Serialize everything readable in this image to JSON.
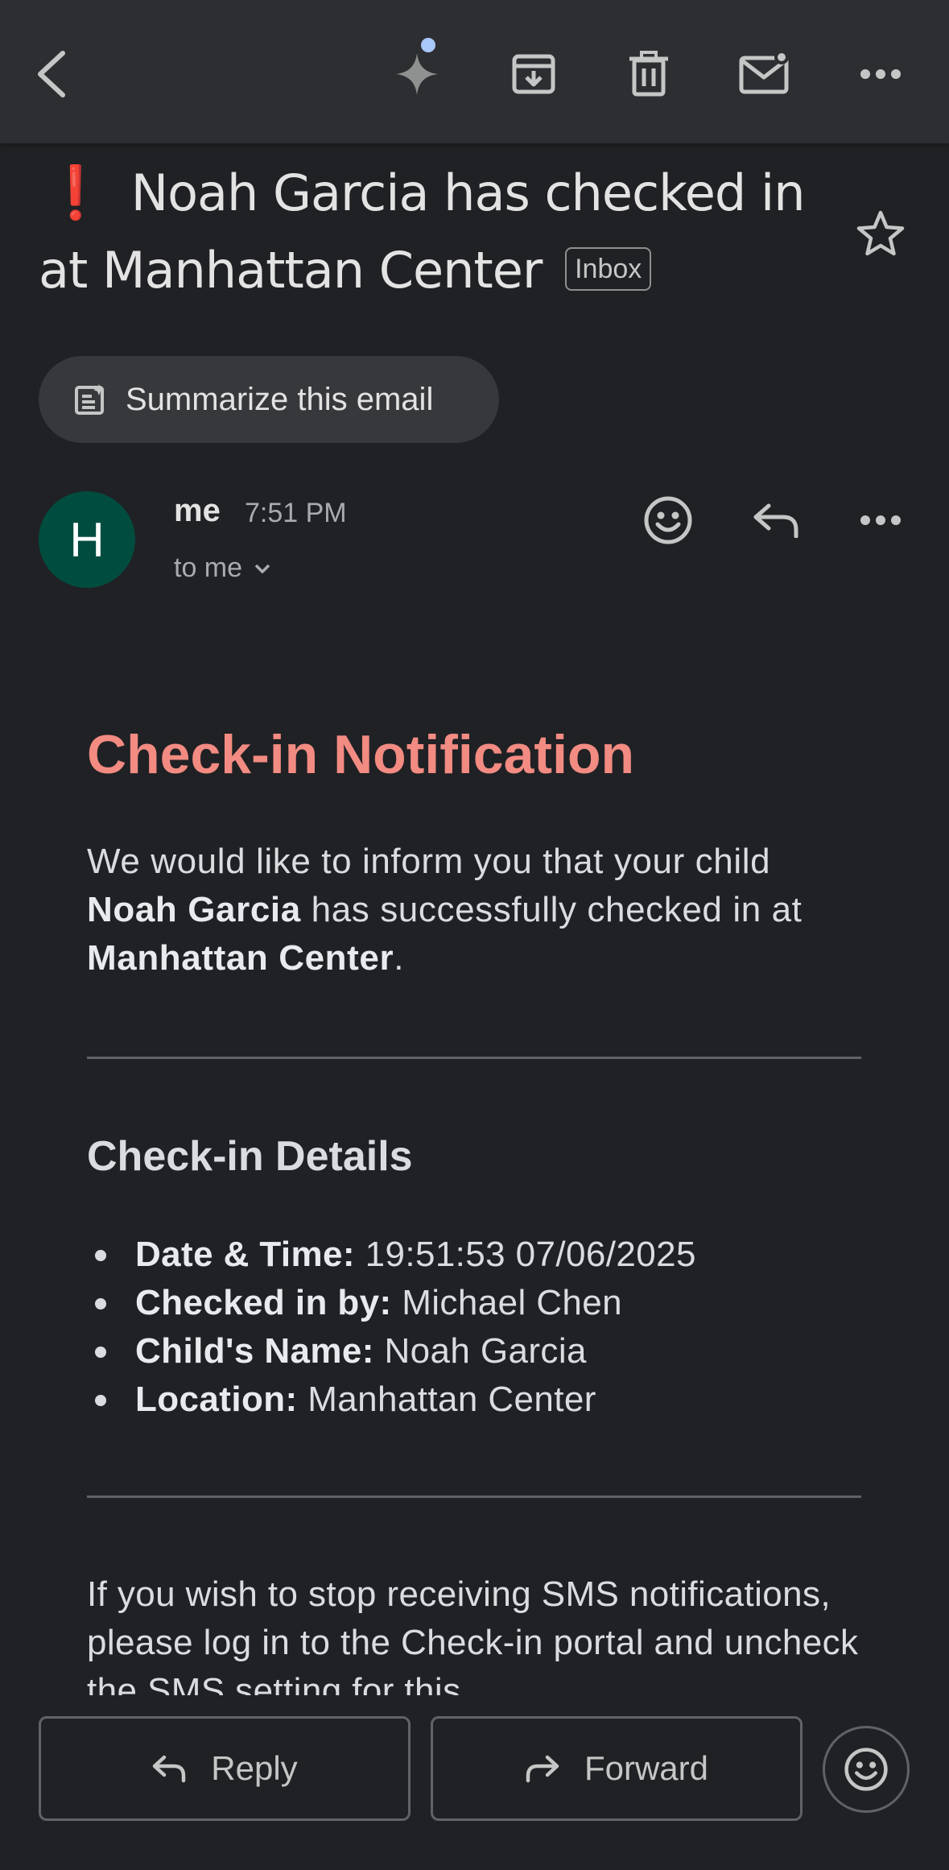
{
  "toolbar": {
    "back_icon": "arrow-back-icon",
    "gemini_icon": "gemini-sparkle-icon",
    "archive_icon": "archive-icon",
    "delete_icon": "trash-icon",
    "unread_icon": "mark-unread-icon",
    "more_icon": "more-horizontal-icon"
  },
  "email": {
    "importance_marker": "❗",
    "subject": "Noah Garcia has checked in at Manhattan Center",
    "label_chip": "Inbox",
    "star_icon": "star-outline-icon"
  },
  "summarize": {
    "label": "Summarize this email",
    "icon": "summary-doc-icon"
  },
  "sender": {
    "avatar_letter": "H",
    "avatar_color": "#004d40",
    "name": "me",
    "time": "7:51 PM",
    "recipient": "to me"
  },
  "message": {
    "heading": "Check-in Notification",
    "heading_color": "#f28b82",
    "intro_pre": "We would like to inform you that your child ",
    "child_name": "Noah Garcia",
    "intro_mid": " has successfully checked in at ",
    "location": "Manhattan Center",
    "intro_end": ".",
    "details_heading": "Check-in Details",
    "details": [
      {
        "label": "Date & Time:",
        "value": " 19:51:53 07/06/2025"
      },
      {
        "label": "Checked in by:",
        "value": " Michael Chen"
      },
      {
        "label": "Child's Name:",
        "value": " Noah Garcia"
      },
      {
        "label": "Location:",
        "value": " Manhattan Center"
      }
    ],
    "footer": "If you wish to stop receiving SMS notifications, please log in to the Check-in portal and uncheck the SMS setting for this"
  },
  "actions": {
    "reply_label": "Reply",
    "forward_label": "Forward",
    "emoji_icon": "emoji-reaction-icon"
  }
}
